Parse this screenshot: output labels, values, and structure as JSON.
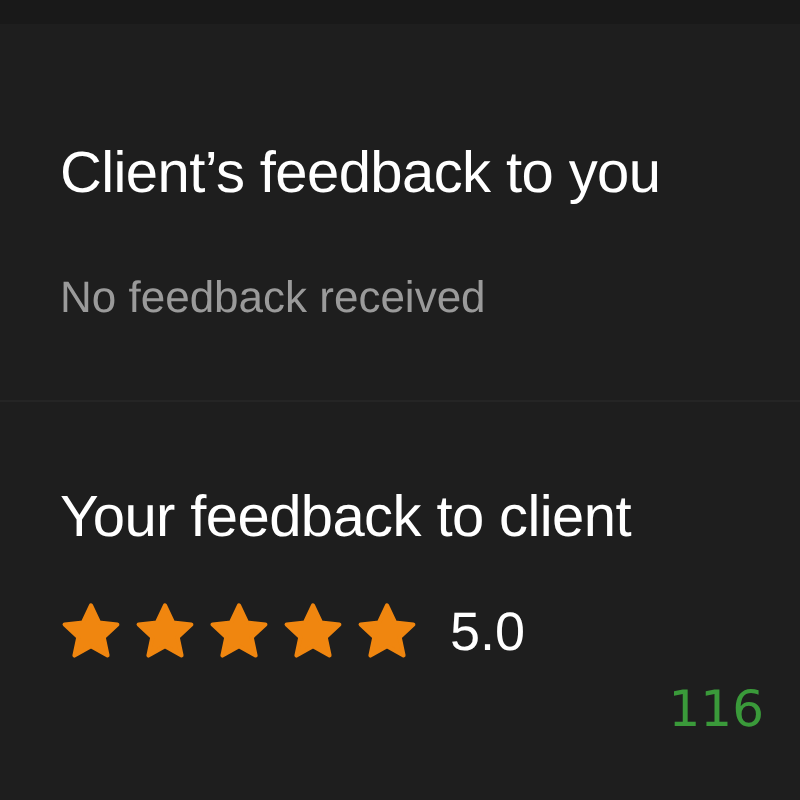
{
  "client_feedback": {
    "title": "Client’s feedback to you",
    "message": "No feedback received"
  },
  "your_feedback": {
    "title": "Your feedback to client",
    "stars": 5,
    "score": "5.0"
  },
  "counter": "116"
}
